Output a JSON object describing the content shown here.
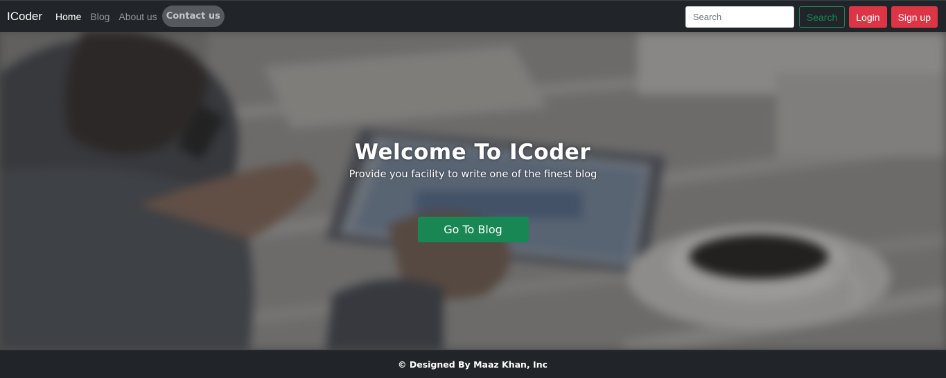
{
  "nav": {
    "brand": "ICoder",
    "links": [
      {
        "label": "Home"
      },
      {
        "label": "Blog"
      },
      {
        "label": "About us"
      },
      {
        "label": "Contact us"
      }
    ],
    "search_placeholder": "Search",
    "search_button": "Search",
    "login_button": "Login",
    "signup_button": "Sign up"
  },
  "hero": {
    "title": "Welcome To ICoder",
    "subtitle": "Provide you facility to write one of the finest blog",
    "cta": "Go To Blog"
  },
  "footer": {
    "text": "© Designed By Maaz Khan, Inc"
  },
  "colors": {
    "navbar_bg": "#212529",
    "success": "#198754",
    "danger": "#dc3545"
  }
}
